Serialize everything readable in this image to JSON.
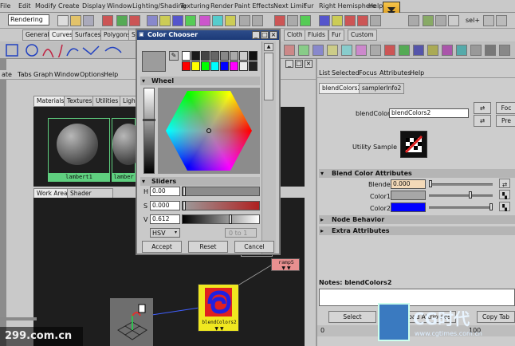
{
  "menubar": {
    "items": [
      "File",
      "Edit",
      "Modify",
      "Create",
      "Display",
      "Window",
      "Lighting/Shading",
      "Texturing",
      "Render",
      "Paint Effects",
      "Next Limit",
      "Fur",
      "Right Hemisphere",
      "Help"
    ]
  },
  "toolbar": {
    "mode": "Rendering",
    "sel_label": "sel+"
  },
  "shelf": {
    "tabs": [
      "General",
      "Curves",
      "Surfaces",
      "Polygons",
      "S",
      "Cloth",
      "Fluids",
      "Fur",
      "Custom"
    ],
    "active": "Curves"
  },
  "hypershade": {
    "menu": [
      "ate",
      "Tabs",
      "Graph",
      "Window",
      "Options",
      "Help"
    ],
    "top_tabs": [
      "Materials",
      "Textures",
      "Utilities",
      "Lights"
    ],
    "swatches": [
      "lambert1",
      "lamber"
    ],
    "work_tabs": [
      "Work Area",
      "Shader Library"
    ],
    "nodes": {
      "ramp": "ramp5",
      "blend": "blendColors2",
      "texture": "xture8"
    }
  },
  "color_chooser": {
    "title": "Color Chooser",
    "wheel_label": "Wheel",
    "sliders_label": "Sliders",
    "h_label": "H",
    "h_value": "0.00",
    "s_label": "S",
    "s_value": "0.000",
    "v_label": "V",
    "v_value": "0.612",
    "mode": "HSV",
    "range": "0 to 1",
    "accept": "Accept",
    "reset": "Reset",
    "cancel": "Cancel",
    "palette": [
      "#ffffff",
      "#1a1a1a",
      "#444444",
      "#666666",
      "#888888",
      "#aaaaaa",
      "#cccccc",
      "#111111",
      "#ff0000",
      "#ffff00",
      "#00ff00",
      "#00ffff",
      "#0000ff",
      "#ff00ff",
      "#eeeeee",
      "#222222"
    ]
  },
  "attr_editor": {
    "menu": [
      "List",
      "Selected",
      "Focus",
      "Attributes",
      "Help"
    ],
    "tabs": [
      "blendColors2",
      "samplerInfo2"
    ],
    "type_label": "blendColors:",
    "type_value": "blendColors2",
    "focus_btn": "Foc",
    "presets_btn": "Pre",
    "utility_sample": "Utility Sample",
    "section": "Blend Color Attributes",
    "blender_label": "Blender",
    "blender_value": "0.000",
    "color1_label": "Color1",
    "color1": "#a7a7a7",
    "color2_label": "Color2",
    "color2": "#0000ff",
    "node_behavior": "Node Behavior",
    "extra_attributes": "Extra Attributes",
    "notes_label": "Notes:  blendColors2",
    "select_btn": "Select",
    "load_btn": "Load Attributes",
    "copy_btn": "Copy Tab",
    "numbers": [
      "0",
      "80",
      "100"
    ]
  },
  "watermark": {
    "left": "299.com.cn",
    "right_cg": "CG时代",
    "right_url": "www.cgtimes.com.cn"
  }
}
